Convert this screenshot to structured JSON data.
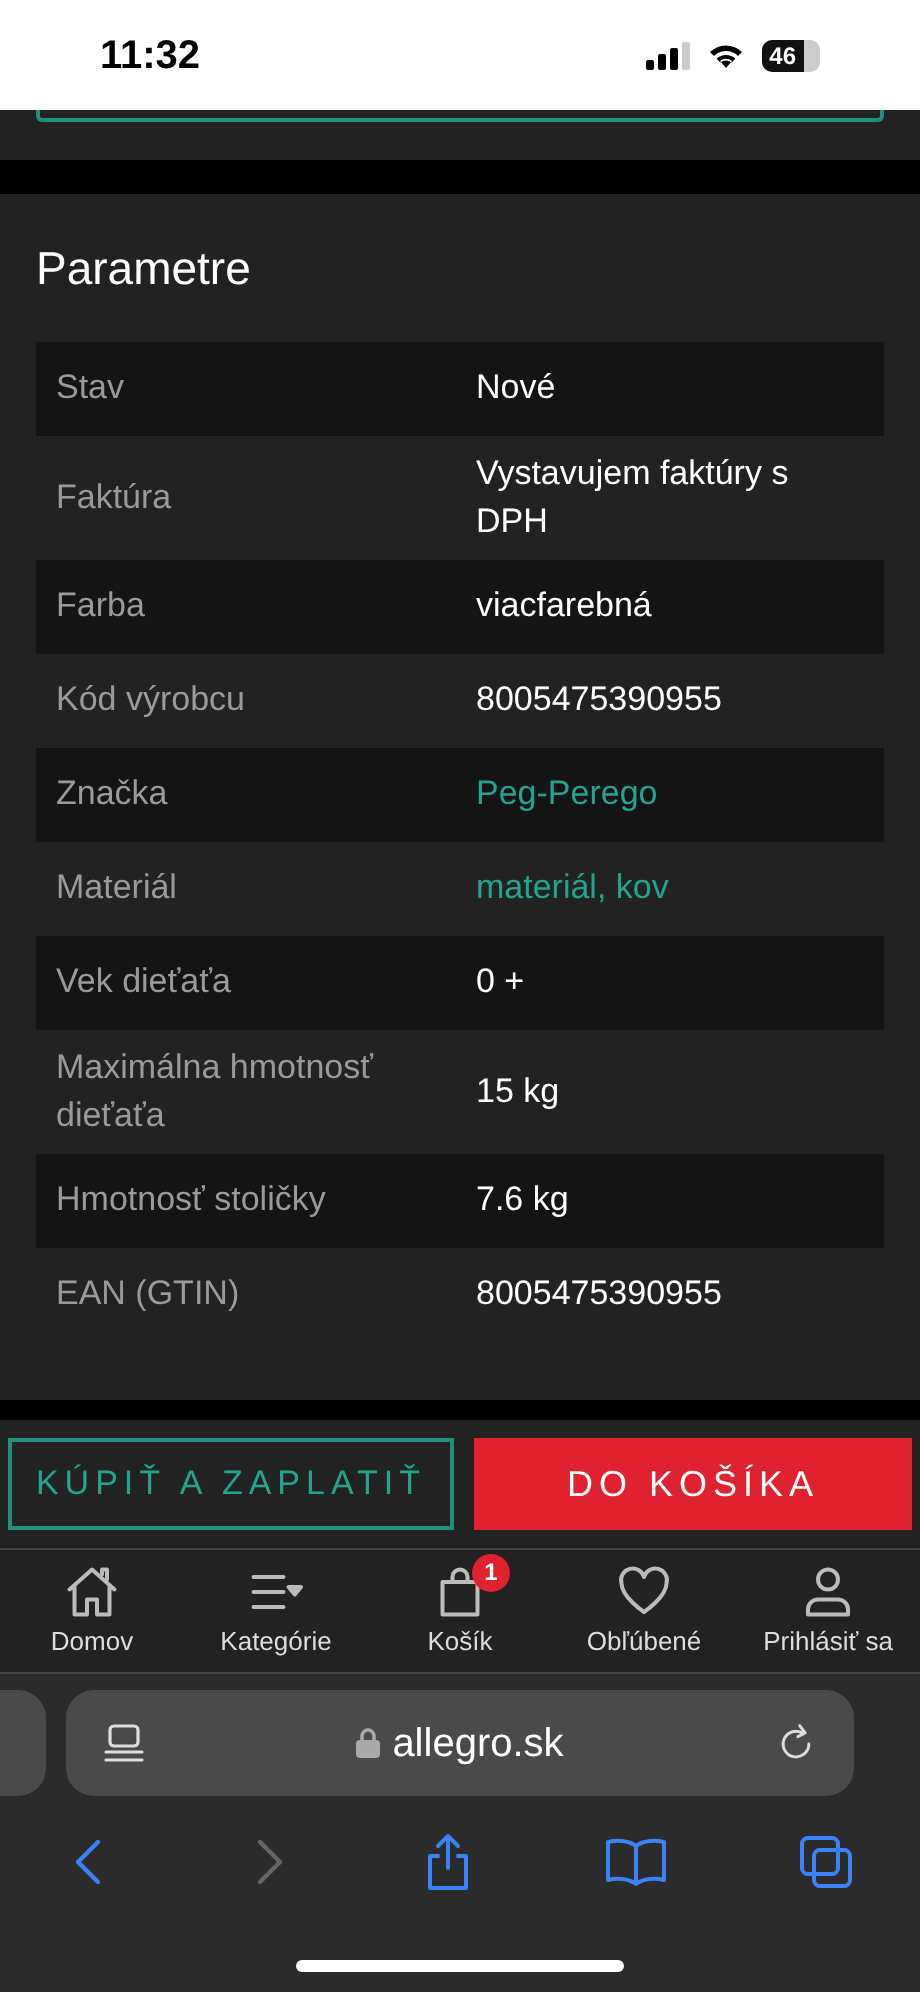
{
  "status_bar": {
    "time": "11:32",
    "battery": "46"
  },
  "parameters": {
    "title": "Parametre",
    "rows": [
      {
        "label": "Stav",
        "value": "Nové",
        "kind": "text"
      },
      {
        "label": "Faktúra",
        "value": "Vystavujem faktúry s DPH",
        "kind": "text"
      },
      {
        "label": "Farba",
        "value": "viacfarebná",
        "kind": "text"
      },
      {
        "label": "Kód výrobcu",
        "value": "8005475390955",
        "kind": "text"
      },
      {
        "label": "Značka",
        "value": "Peg-Perego",
        "kind": "link"
      },
      {
        "label": "Materiál",
        "value": "materiál, kov",
        "kind": "link"
      },
      {
        "label": "Vek dieťaťa",
        "value": "0 +",
        "kind": "text"
      },
      {
        "label": "Maximálna hmotnosť dieťaťa",
        "value": "15 kg",
        "kind": "text"
      },
      {
        "label": "Hmotnosť stoličky",
        "value": "7.6 kg",
        "kind": "text"
      },
      {
        "label": "EAN (GTIN)",
        "value": "8005475390955",
        "kind": "text"
      }
    ]
  },
  "actions": [
    {
      "label": "KÚPIŤ A ZAPLATIŤ",
      "kind": "outline"
    },
    {
      "label": "DO KOŠÍKA",
      "kind": "primary"
    }
  ],
  "bottom_nav": [
    {
      "label": "Domov",
      "kind": "home"
    },
    {
      "label": "Kategórie",
      "kind": "menu"
    },
    {
      "label": "Košík",
      "kind": "bag",
      "badge": "1"
    },
    {
      "label": "Obľúbené",
      "kind": "heart"
    },
    {
      "label": "Prihlásiť sa",
      "kind": "user"
    }
  ],
  "browser": {
    "url": "allegro.sk"
  }
}
